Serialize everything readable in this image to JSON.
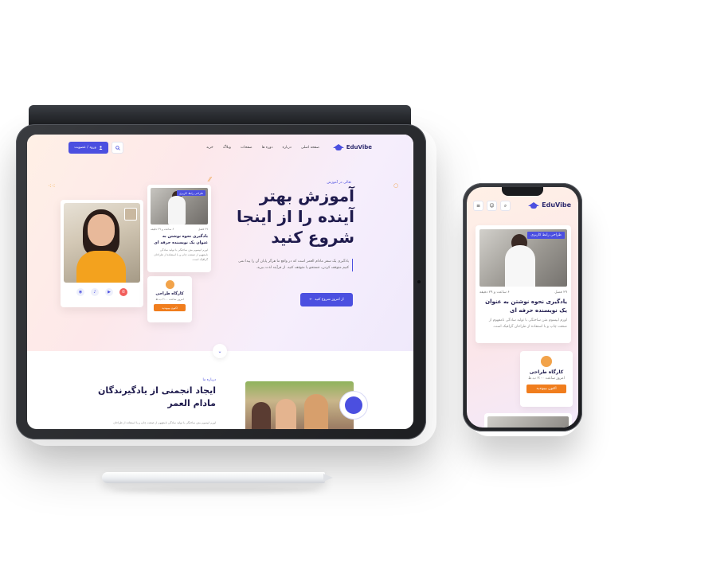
{
  "site": {
    "logo": "EduVibe",
    "nav": [
      "صفحه اصلی",
      "درباره",
      "دوره ها",
      "صفحات",
      "وبلاگ",
      "خرید"
    ],
    "login_label": "ورود / عضویت"
  },
  "hero": {
    "subtitle": "تعالی در آموزش",
    "title": "آموزش بهتر آینده را از اینجا شروع کنید",
    "description": "یادگیری یک سفر مادام العمر است که در واقع ما هرگز پایان آن را پیدا نمی کنیم متوقف کردن، جستجو یا متوقف کنید. از فرآیند لذت ببرید.",
    "cta_label": "از امروز شروع کنید"
  },
  "course_card": {
    "badge": "طراحی رابط کاربری",
    "lessons": "۲۹ فصل",
    "duration": "۶ ساعت و ۲۹ دقیقه",
    "title": "یادگیری نحوه نوشتن به عنوان یک نویسنده حرفه ای",
    "description": "لورم ایپسوم متن ساختگی با تولید سادگی نامفهوم از صنعت چاپ و با استفاده از طراحان گرافیک است."
  },
  "workshop": {
    "title": "کارگاه طراحی",
    "time": "امروز ساعت ۲:۰۰ ب.ظ",
    "button": "اکنون بپیوندید"
  },
  "about": {
    "subtitle": "درباره ما",
    "title": "ایجاد انجمنی از یادگیرندگان مادام العمر",
    "text": "لورم ایپسوم متن ساختگی با تولید سادگی نامفهوم از صنعت چاپ و با استفاده از طراحان"
  },
  "icons": {
    "search": "search-icon",
    "user": "user-icon",
    "menu": "hamburger-icon",
    "arrow": "arrow-left-icon",
    "scroll": "chevron-down-icon"
  },
  "colors": {
    "primary": "#4b4fe0",
    "accent": "#f07d1d",
    "dark": "#1f1b4d"
  }
}
